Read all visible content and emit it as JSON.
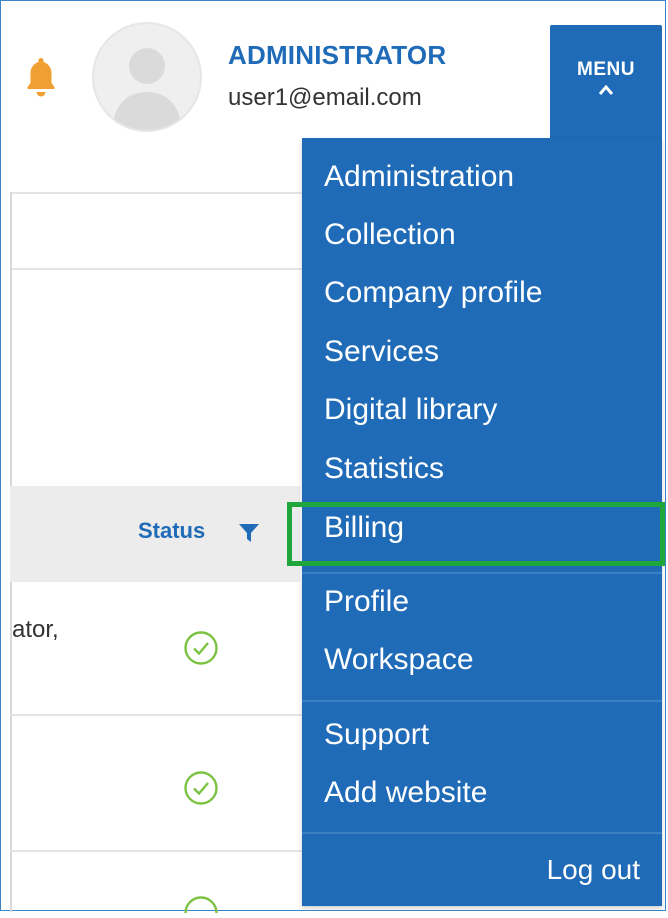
{
  "header": {
    "user_role": "ADMINISTRATOR",
    "user_email": "user1@email.com",
    "menu_label": "MENU"
  },
  "table": {
    "status_header": "Status",
    "row1_partial_text": "ator,"
  },
  "dropdown": {
    "items": [
      {
        "label": "Administration"
      },
      {
        "label": "Collection"
      },
      {
        "label": "Company profile"
      },
      {
        "label": "Services"
      },
      {
        "label": "Digital library"
      },
      {
        "label": "Statistics"
      },
      {
        "label": "Billing"
      },
      {
        "label": "Profile"
      },
      {
        "label": "Workspace"
      },
      {
        "label": "Support"
      },
      {
        "label": "Add website"
      }
    ],
    "logout_label": "Log out",
    "highlighted_item": "Billing"
  },
  "colors": {
    "brand_blue": "#1f6bb7",
    "highlight_green": "#1fa63c",
    "bell_orange": "#f0a032",
    "check_green": "#7cc242"
  }
}
